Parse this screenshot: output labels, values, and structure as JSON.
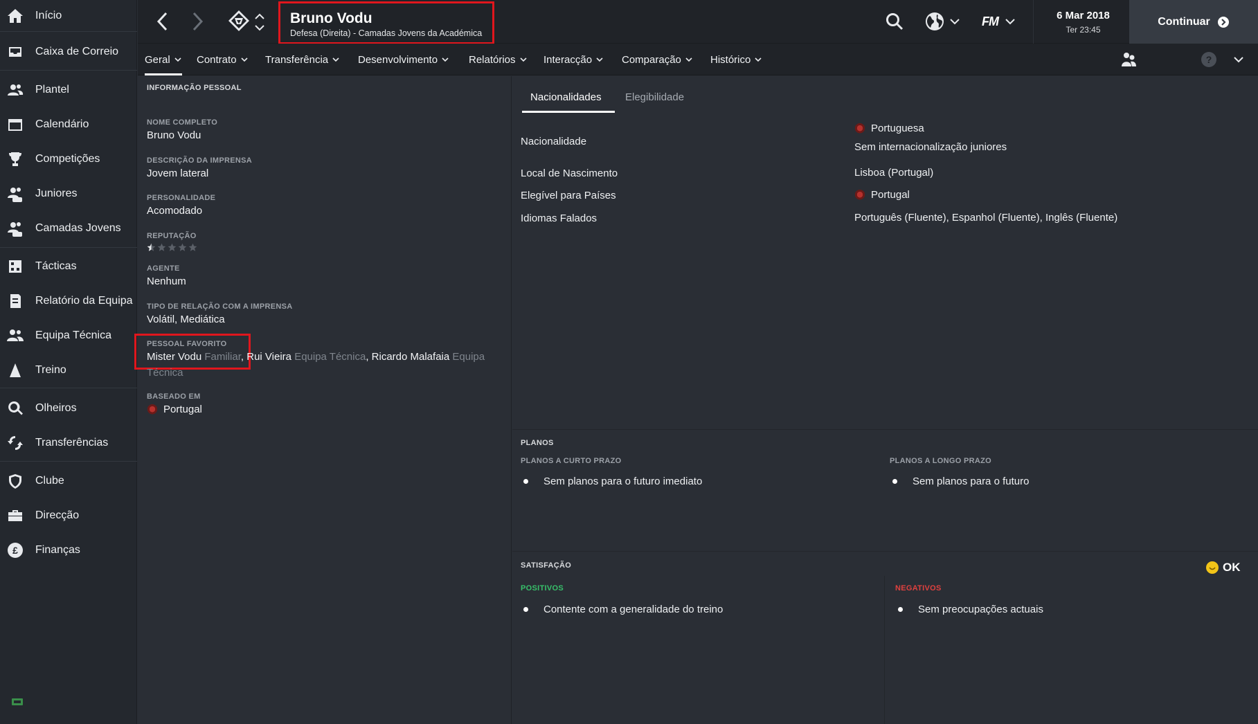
{
  "sidebar": {
    "items": [
      {
        "label": "Início",
        "icon": "home-icon"
      },
      {
        "label": "Caixa de Correio",
        "icon": "inbox-icon"
      },
      {
        "label": "Plantel",
        "icon": "squad-icon"
      },
      {
        "label": "Calendário",
        "icon": "calendar-icon"
      },
      {
        "label": "Competições",
        "icon": "trophy-icon"
      },
      {
        "label": "Juniores",
        "icon": "juniors-icon"
      },
      {
        "label": "Camadas Jovens",
        "icon": "youth-icon"
      },
      {
        "label": "Tácticas",
        "icon": "tactics-icon"
      },
      {
        "label": "Relatório da Equipa",
        "icon": "report-icon"
      },
      {
        "label": "Equipa Técnica",
        "icon": "staff-icon"
      },
      {
        "label": "Treino",
        "icon": "training-icon"
      },
      {
        "label": "Olheiros",
        "icon": "scouting-icon"
      },
      {
        "label": "Transferências",
        "icon": "transfers-icon"
      },
      {
        "label": "Clube",
        "icon": "club-icon"
      },
      {
        "label": "Direcção",
        "icon": "board-icon"
      },
      {
        "label": "Finanças",
        "icon": "finances-icon"
      }
    ]
  },
  "header": {
    "player_name": "Bruno Vodu",
    "player_subtitle": "Defesa (Direita) - Camadas Jovens da Académica",
    "date": "6 Mar 2018",
    "time": "Ter 23:45",
    "continue_label": "Continuar",
    "fm_label": "FM"
  },
  "tabs": [
    {
      "label": "Geral"
    },
    {
      "label": "Contrato"
    },
    {
      "label": "Transferência"
    },
    {
      "label": "Desenvolvimento"
    },
    {
      "label": "Relatórios"
    },
    {
      "label": "Interacção"
    },
    {
      "label": "Comparação"
    },
    {
      "label": "Histórico"
    }
  ],
  "personal": {
    "section_title": "INFORMAÇÃO PESSOAL",
    "full_name_label": "NOME COMPLETO",
    "full_name": "Bruno Vodu",
    "press_label": "DESCRIÇÃO DA IMPRENSA",
    "press": "Jovem lateral",
    "personality_label": "PERSONALIDADE",
    "personality": "Acomodado",
    "reputation_label": "REPUTAÇÃO",
    "reputation_stars": 0.5,
    "reputation_max": 5,
    "agent_label": "AGENTE",
    "agent": "Nenhum",
    "media_label": "TIPO DE RELAÇÃO COM A IMPRENSA",
    "media": "Volátil, Mediática",
    "favourite_label": "PESSOAL FAVORITO",
    "favourites": {
      "p1_name": "Mister Vodu",
      "p1_role": "Familiar",
      "p2_name": "Rui Vieira",
      "p2_role": "Equipa Técnica",
      "p3_name": "Ricardo Malafaia",
      "p3_role_a": "Equipa",
      "p3_role_b": "Técnica"
    },
    "based_label": "BASEADO EM",
    "based": "Portugal"
  },
  "nationality": {
    "tab_active": "Nacionalidades",
    "tab_other": "Elegibilidade",
    "rows": {
      "nationality_label": "Nacionalidade",
      "nationality_value": "Portuguesa",
      "nationality_note": "Sem internacionalização juniores",
      "birthplace_label": "Local de Nascimento",
      "birthplace_value": "Lisboa (Portugal)",
      "eligible_label": "Elegível para Países",
      "eligible_value": "Portugal",
      "languages_label": "Idiomas Falados",
      "languages_value": "Português (Fluente), Espanhol (Fluente), Inglês (Fluente)"
    }
  },
  "plans": {
    "title": "PLANOS",
    "short_label": "PLANOS A CURTO PRAZO",
    "short_item": "Sem planos para o futuro imediato",
    "long_label": "PLANOS A LONGO PRAZO",
    "long_item": "Sem planos para o futuro"
  },
  "satisfaction": {
    "title": "SATISFAÇÃO",
    "status": "OK",
    "positives_label": "POSITIVOS",
    "positive_item": "Contente com a generalidade do treino",
    "negatives_label": "NEGATIVOS",
    "negative_item": "Sem preocupações actuais"
  },
  "colors": {
    "highlight_red": "#e0161d",
    "positive_green": "#37c06a",
    "negative_red": "#e0413f",
    "ok_yellow": "#f2c418"
  }
}
